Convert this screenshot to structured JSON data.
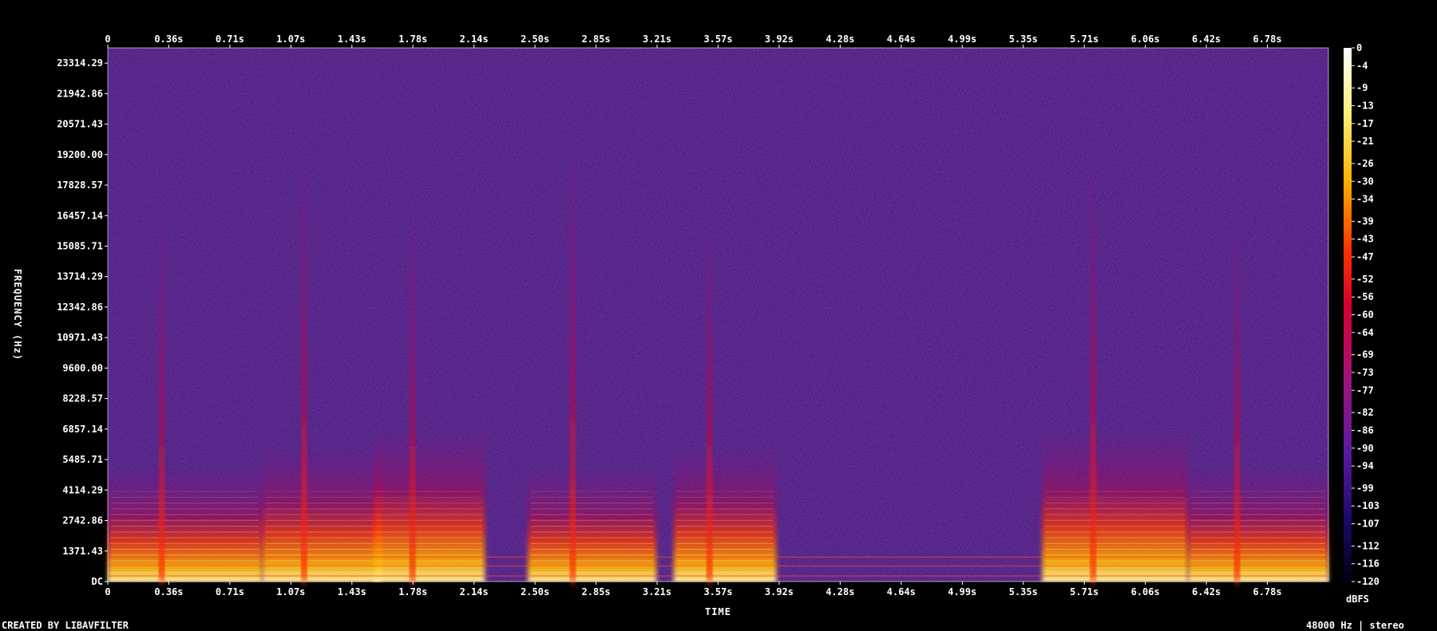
{
  "chart_data": {
    "type": "heatmap",
    "kind": "spectrogram",
    "xlabel": "TIME",
    "ylabel": "FREQUENCY (Hz)",
    "x_ticks": [
      "0",
      "0.36s",
      "0.71s",
      "1.07s",
      "1.43s",
      "1.78s",
      "2.14s",
      "2.50s",
      "2.85s",
      "3.21s",
      "3.57s",
      "3.92s",
      "4.28s",
      "4.64s",
      "4.99s",
      "5.35s",
      "5.71s",
      "6.06s",
      "6.42s",
      "6.78s"
    ],
    "x_tick_values": [
      0,
      0.356,
      0.712,
      1.068,
      1.424,
      1.78,
      2.136,
      2.492,
      2.848,
      3.204,
      3.56,
      3.916,
      4.272,
      4.628,
      4.984,
      5.34,
      5.696,
      6.052,
      6.408,
      6.764
    ],
    "x_range": [
      0,
      7.12
    ],
    "y_ticks": [
      "DC",
      "1371.43",
      "2742.86",
      "4114.29",
      "5485.71",
      "6857.14",
      "8228.57",
      "9600.00",
      "10971.43",
      "12342.86",
      "13714.29",
      "15085.71",
      "16457.14",
      "17828.57",
      "19200.00",
      "20571.43",
      "21942.86",
      "23314.29"
    ],
    "y_range": [
      0,
      24000
    ],
    "colorbar_label": "dBFS",
    "colorbar_ticks": [
      "0",
      "-4",
      "-9",
      "-13",
      "-17",
      "-21",
      "-26",
      "-30",
      "-34",
      "-39",
      "-43",
      "-47",
      "-52",
      "-56",
      "-60",
      "-64",
      "-69",
      "-73",
      "-77",
      "-82",
      "-86",
      "-90",
      "-94",
      "-99",
      "-103",
      "-107",
      "-112",
      "-116",
      "-120"
    ],
    "colorbar_range": [
      -120,
      0
    ],
    "colormap": "intensity",
    "speech_segments_s": [
      [
        0.0,
        0.9
      ],
      [
        0.9,
        1.6
      ],
      [
        1.55,
        2.2
      ],
      [
        2.45,
        3.2
      ],
      [
        3.3,
        3.9
      ],
      [
        5.45,
        6.3
      ],
      [
        6.3,
        7.12
      ]
    ],
    "footer_left": "CREATED BY LIBAVFILTER",
    "footer_right": "48000 Hz | stereo"
  },
  "colors": {
    "background": "#000000",
    "noise_floor": "#4a1e82",
    "text": "#ffffff"
  }
}
